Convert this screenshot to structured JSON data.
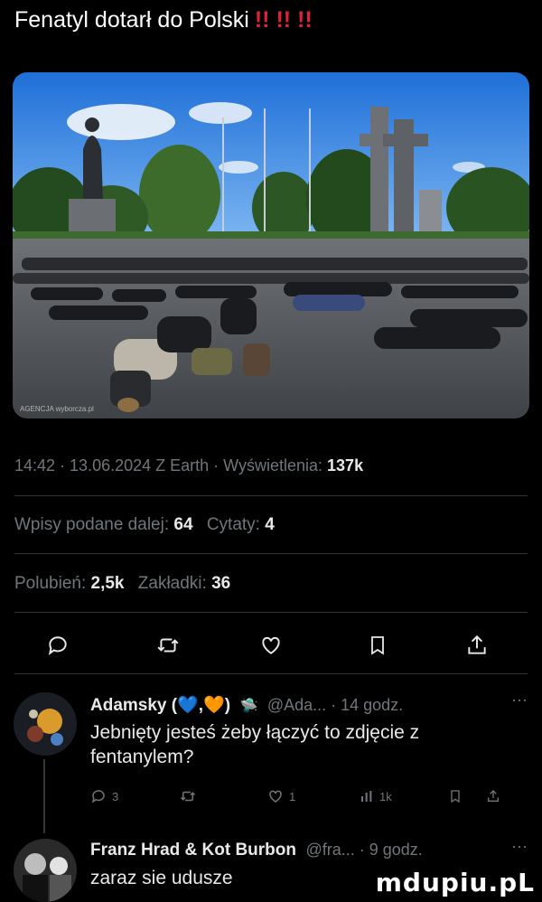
{
  "header": {
    "title": "Fenatyl dotarł do Polski",
    "emphasis": "!! !! !!"
  },
  "post": {
    "photo_credit": "AGENCJA wyborcza.pl",
    "time_date_source": "14:42 · 13.06.2024 Z Earth · Wyświetlenia:",
    "views": "137k",
    "quotes_label": "Wpisy podane dalej:",
    "quotes_count": "64",
    "citations_label": "Cytaty:",
    "citations_count": "4",
    "likes_label": "Polubień:",
    "likes_count": "2,5k",
    "bookmarks_label": "Zakładki:",
    "bookmarks_count": "36"
  },
  "actions": [
    "reply-icon",
    "retweet-icon",
    "like-icon",
    "bookmark-icon",
    "share-icon"
  ],
  "replies": [
    {
      "name": "Adamsky (💙,🧡)",
      "handle_time": "@Ada... · 14 godz.",
      "text": "Jebnięty jesteś żeby łączyć to zdjęcie z fentanylem?",
      "reply_count": "3",
      "like_count": "1",
      "view_count": "1k"
    },
    {
      "name": "Franz Hrad & Kot Burbon",
      "handle_time": "@fra... · 9 godz.",
      "text": "zaraz sie udusze"
    }
  ],
  "watermark": "mdupiu.pL",
  "colors": {
    "background": "#000000",
    "text": "#e7e9ea",
    "muted": "#71767b",
    "divider": "#2f3336",
    "emphasis": "#e0213a"
  }
}
